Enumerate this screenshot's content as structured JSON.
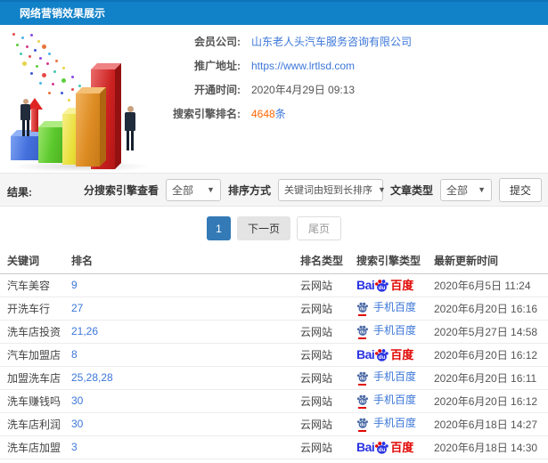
{
  "header": {
    "title": "网络营销效果展示"
  },
  "info": {
    "fields": [
      {
        "label": "会员公司:",
        "value": "山东老人头汽车服务咨询有限公司"
      },
      {
        "label": "推广地址:",
        "value": "https://www.lrtlsd.com"
      },
      {
        "label": "开通时间:",
        "value": "2020年4月29日 09:13"
      },
      {
        "label": "搜索引擎排名:",
        "value": "4648",
        "suffix": "条"
      }
    ]
  },
  "filters": {
    "result_label": "结果:",
    "engine_label": "分搜索引擎查看",
    "engine_value": "全部",
    "sort_label": "排序方式",
    "sort_value": "关键词由短到长排序",
    "article_label": "文章类型",
    "article_value": "全部",
    "submit_label": "提交"
  },
  "pagination": {
    "current": "1",
    "next_label": "下一页",
    "last_label": "尾页"
  },
  "table": {
    "headers": [
      "关键词",
      "排名",
      "排名类型",
      "搜索引擎类型",
      "最新更新时间"
    ],
    "rows": [
      {
        "keyword": "汽车美容",
        "rank": "9",
        "rank_type": "云网站",
        "engine": "baidu",
        "time": "2020年6月5日 11:24"
      },
      {
        "keyword": "开洗车行",
        "rank": "27",
        "rank_type": "云网站",
        "engine": "mobile-baidu",
        "time": "2020年6月20日 16:16"
      },
      {
        "keyword": "洗车店投资",
        "rank": "21,26",
        "rank_type": "云网站",
        "engine": "mobile-baidu",
        "time": "2020年5月27日 14:58"
      },
      {
        "keyword": "汽车加盟店",
        "rank": "8",
        "rank_type": "云网站",
        "engine": "baidu",
        "time": "2020年6月20日 16:12"
      },
      {
        "keyword": "加盟洗车店",
        "rank": "25,28,28",
        "rank_type": "云网站",
        "engine": "mobile-baidu",
        "time": "2020年6月20日 16:11"
      },
      {
        "keyword": "洗车赚钱吗",
        "rank": "30",
        "rank_type": "云网站",
        "engine": "mobile-baidu",
        "time": "2020年6月20日 16:12"
      },
      {
        "keyword": "洗车店利润",
        "rank": "30",
        "rank_type": "云网站",
        "engine": "mobile-baidu",
        "time": "2020年6月18日 14:27"
      },
      {
        "keyword": "洗车店加盟",
        "rank": "3",
        "rank_type": "云网站",
        "engine": "baidu",
        "time": "2020年6月18日 14:30"
      }
    ]
  },
  "logos": {
    "baidu": {
      "bai": "Bai",
      "du": "du",
      "cn": "百度"
    },
    "mobile_baidu": {
      "du": "du",
      "text": "手机百度"
    }
  },
  "colors": {
    "header_bg": "#1181c8",
    "link_blue": "#3c77d9",
    "rank_count_orange": "#ff6600",
    "active_page_blue": "#337ab7",
    "baidu_blue": "#2932e1",
    "baidu_red": "#e10602"
  }
}
